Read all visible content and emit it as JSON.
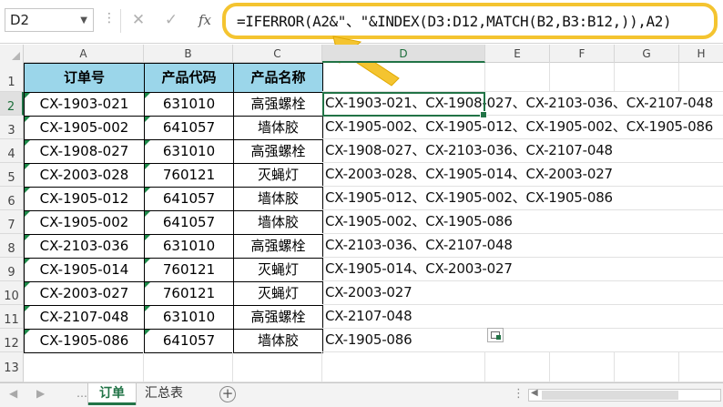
{
  "formula_bar": {
    "name_box": "D2",
    "cancel_icon": "✕",
    "enter_icon": "✓",
    "function_icon": "fx",
    "formula": "=IFERROR(A2&\"、\"&INDEX(D3:D12,MATCH(B2,B3:B12,)),A2)"
  },
  "columns": [
    "A",
    "B",
    "C",
    "D",
    "E",
    "F",
    "G",
    "H"
  ],
  "rows": [
    "1",
    "2",
    "3",
    "4",
    "5",
    "6",
    "7",
    "8",
    "9",
    "10",
    "11",
    "12",
    "13"
  ],
  "table": {
    "headers": [
      "订单号",
      "产品代码",
      "产品名称"
    ],
    "body": [
      {
        "order": "CX-1903-021",
        "code": "631010",
        "name": "高强螺栓",
        "concat": "CX-1903-021、CX-1908-027、CX-2103-036、CX-2107-048"
      },
      {
        "order": "CX-1905-002",
        "code": "641057",
        "name": "墙体胶",
        "concat": "CX-1905-002、CX-1905-012、CX-1905-002、CX-1905-086"
      },
      {
        "order": "CX-1908-027",
        "code": "631010",
        "name": "高强螺栓",
        "concat": "CX-1908-027、CX-2103-036、CX-2107-048"
      },
      {
        "order": "CX-2003-028",
        "code": "760121",
        "name": "灭蝇灯",
        "concat": "CX-2003-028、CX-1905-014、CX-2003-027"
      },
      {
        "order": "CX-1905-012",
        "code": "641057",
        "name": "墙体胶",
        "concat": "CX-1905-012、CX-1905-002、CX-1905-086"
      },
      {
        "order": "CX-1905-002",
        "code": "641057",
        "name": "墙体胶",
        "concat": "CX-1905-002、CX-1905-086"
      },
      {
        "order": "CX-2103-036",
        "code": "631010",
        "name": "高强螺栓",
        "concat": "CX-2103-036、CX-2107-048"
      },
      {
        "order": "CX-1905-014",
        "code": "760121",
        "name": "灭蝇灯",
        "concat": "CX-1905-014、CX-2003-027"
      },
      {
        "order": "CX-2003-027",
        "code": "760121",
        "name": "灭蝇灯",
        "concat": "CX-2003-027"
      },
      {
        "order": "CX-2107-048",
        "code": "631010",
        "name": "高强螺栓",
        "concat": "CX-2107-048"
      },
      {
        "order": "CX-1905-086",
        "code": "641057",
        "name": "墙体胶",
        "concat": "CX-1905-086"
      }
    ]
  },
  "sheet_tabs": [
    {
      "label": "订单",
      "active": true
    },
    {
      "label": "汇总表",
      "active": false
    }
  ],
  "add_sheet_icon": "+",
  "colors": {
    "header_fill": "#9bd6ea",
    "callout": "#f4c430",
    "excel_green": "#217346"
  }
}
